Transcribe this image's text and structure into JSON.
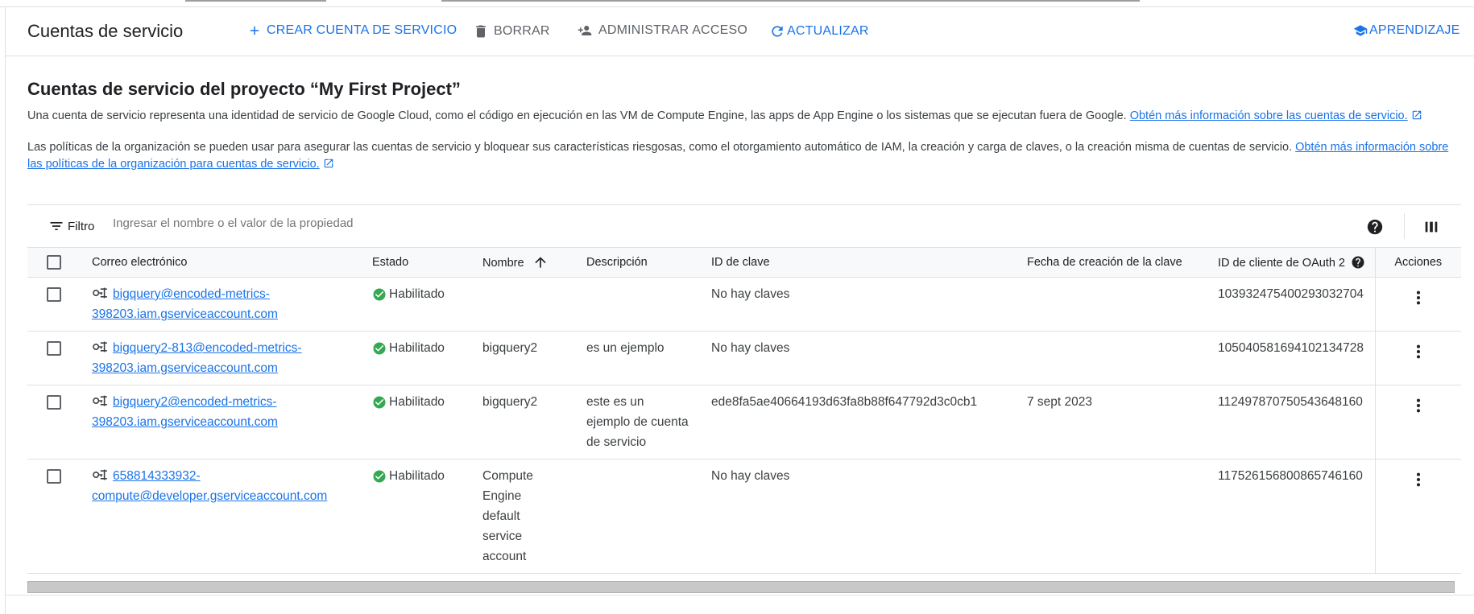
{
  "toolbar": {
    "title": "Cuentas de servicio",
    "create_label": "CREAR CUENTA DE SERVICIO",
    "delete_label": "BORRAR",
    "manage_access_label": "ADMINISTRAR ACCESO",
    "refresh_label": "ACTUALIZAR",
    "learn_label": "APRENDIZAJE"
  },
  "main": {
    "heading": "Cuentas de servicio del proyecto “My First Project”",
    "para1_text": "Una cuenta de servicio representa una identidad de servicio de Google Cloud, como el código en ejecución en las VM de Compute Engine, las apps de App Engine o los sistemas que se ejecutan fuera de Google.",
    "para1_link": "Obtén más información sobre las cuentas de servicio.",
    "para2_text": "Las políticas de la organización se pueden usar para asegurar las cuentas de servicio y bloquear sus características riesgosas, como el otorgamiento automático de IAM, la creación y carga de claves, o la creación misma de cuentas de servicio.",
    "para2_link": "Obtén más información sobre las políticas de la organización para cuentas de servicio."
  },
  "filter": {
    "label": "Filtro",
    "placeholder": "Ingresar el nombre o el valor de la propiedad"
  },
  "table": {
    "headers": {
      "email": "Correo electrónico",
      "status": "Estado",
      "name": "Nombre",
      "description": "Descripción",
      "key_id": "ID de clave",
      "key_date": "Fecha de creación de la clave",
      "oauth_id": "ID de cliente de OAuth 2",
      "actions": "Acciones"
    },
    "sort": {
      "column": "Nombre",
      "direction": "ascending"
    },
    "rows": [
      {
        "email_line1": "bigquery@encoded-metrics-",
        "email_line2": "398203.iam.gserviceaccount.com",
        "status": "Habilitado",
        "name": "",
        "description": "",
        "key_id": "No hay claves",
        "key_date": "",
        "oauth_id": "103932475400293032704"
      },
      {
        "email_line1": "bigquery2-813@encoded-metrics-",
        "email_line2": "398203.iam.gserviceaccount.com",
        "status": "Habilitado",
        "name": "bigquery2",
        "description": "es un ejemplo",
        "key_id": "No hay claves",
        "key_date": "",
        "oauth_id": "105040581694102134728"
      },
      {
        "email_line1": "bigquery2@encoded-metrics-",
        "email_line2": "398203.iam.gserviceaccount.com",
        "status": "Habilitado",
        "name": "bigquery2",
        "description": "este es un ejemplo de cuenta de servicio",
        "key_id": "ede8fa5ae40664193d63fa8b88f647792d3c0cb1",
        "key_date": "7 sept 2023",
        "oauth_id": "112497870750543648160"
      },
      {
        "email_line1": "658814333932-",
        "email_line2": "compute@developer.gserviceaccount.com",
        "status": "Habilitado",
        "name": "Compute Engine default service account",
        "description": "",
        "key_id": "No hay claves",
        "key_date": "",
        "oauth_id": "117526156800865746160"
      }
    ]
  },
  "colors": {
    "accent": "#1a73e8",
    "status_ok": "#34a853",
    "text": "#202124",
    "muted": "#5f6368"
  },
  "icons": {
    "create": "plus-icon",
    "delete": "trash-icon",
    "manage_access": "person-add-icon",
    "refresh": "refresh-icon",
    "learn": "school-icon",
    "filter": "filter-icon",
    "help": "help-icon",
    "columns": "column-display-icon",
    "service_account": "service-account-icon",
    "status": "check-circle-icon",
    "more": "more-vert-icon",
    "sort": "arrow-up-icon",
    "external": "external-link-icon"
  }
}
